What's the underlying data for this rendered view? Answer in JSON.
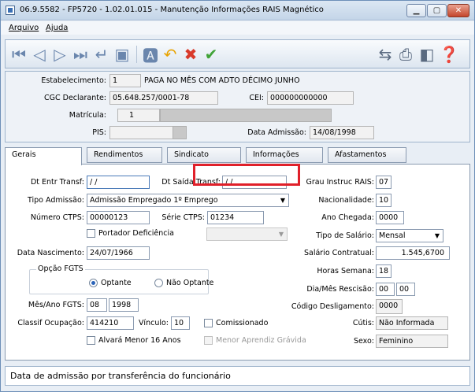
{
  "window": {
    "title": "06.9.5582 - FP5720 - 1.02.01.015 - Manutenção Informações RAIS Magnético"
  },
  "menu": {
    "arquivo": "Arquivo",
    "ajuda": "Ajuda"
  },
  "header": {
    "estabelecimento_label": "Estabelecimento:",
    "estabelecimento_code": "1",
    "estabelecimento_name": "PAGA NO MÊS COM ADTO DÉCIMO JUNHO",
    "cgc_label": "CGC Declarante:",
    "cgc_value": "05.648.257/0001-78",
    "cei_label": "CEI:",
    "cei_value": "000000000000",
    "matricula_label": "Matrícula:",
    "matricula_value": "1",
    "pis_label": "PIS:",
    "data_admissao_label": "Data Admissão:",
    "data_admissao_value": "14/08/1998"
  },
  "tabs": [
    "Gerais",
    "Rendimentos",
    "Sindicato",
    "Informações",
    "Afastamentos"
  ],
  "form": {
    "dt_entr_label": "Dt Entr Transf:",
    "dt_entr_value": "/ /",
    "dt_saida_label": "Dt Saída Transf:",
    "dt_saida_value": "/ /",
    "tipo_admissao_label": "Tipo Admissão:",
    "tipo_admissao_value": "Admissão Empregado 1º Emprego",
    "numero_ctps_label": "Número CTPS:",
    "numero_ctps_value": "00000123",
    "serie_ctps_label": "Série CTPS:",
    "serie_ctps_value": "01234",
    "portador_label": "Portador Deficiência",
    "data_nasc_label": "Data Nascimento:",
    "data_nasc_value": "24/07/1966",
    "opcao_fgts_label": "Opção FGTS",
    "optante_label": "Optante",
    "nao_optante_label": "Não Optante",
    "mes_ano_fgts_label": "Mês/Ano FGTS:",
    "mes_fgts_value": "08",
    "ano_fgts_value": "1998",
    "classif_label": "Classif Ocupação:",
    "classif_value": "414210",
    "vinculo_label": "Vínculo:",
    "vinculo_value": "10",
    "comissionado_label": "Comissionado",
    "alvara_label": "Alvará Menor 16 Anos",
    "menor_aprendiz_label": "Menor Aprendiz Grávida",
    "grau_instruc_label": "Grau Instruc RAIS:",
    "grau_instruc_value": "07",
    "nacionalidade_label": "Nacionalidade:",
    "nacionalidade_value": "10",
    "ano_chegada_label": "Ano Chegada:",
    "ano_chegada_value": "0000",
    "tipo_salario_label": "Tipo de Salário:",
    "tipo_salario_value": "Mensal",
    "salario_label": "Salário Contratual:",
    "salario_value": "1.545,6700",
    "horas_label": "Horas Semana:",
    "horas_value": "18",
    "dia_mes_label": "Dia/Mês Rescisão:",
    "dia_value": "00",
    "mes_value": "00",
    "codigo_deslig_label": "Código Desligamento:",
    "codigo_deslig_value": "0000",
    "cutis_label": "Cútis:",
    "cutis_value": "Não Informada",
    "sexo_label": "Sexo:",
    "sexo_value": "Feminino"
  },
  "status": {
    "text": "Data de admissão por transferência do funcionário"
  },
  "colors": {
    "highlight": "#e0202a",
    "accent": "#2a63b8"
  }
}
